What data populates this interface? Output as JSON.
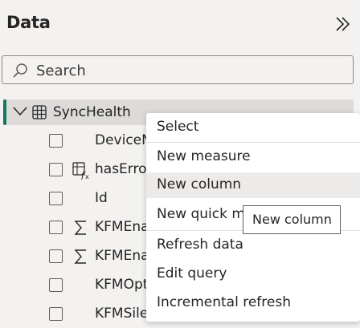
{
  "header": {
    "title": "Data"
  },
  "search": {
    "placeholder": "Search"
  },
  "table": {
    "name": "SyncHealth"
  },
  "fields": [
    {
      "name": "DeviceN",
      "icon": "none"
    },
    {
      "name": "hasError",
      "icon": "calculated-column-icon"
    },
    {
      "name": "Id",
      "icon": "none"
    },
    {
      "name": "KFMEna",
      "icon": "sigma-icon"
    },
    {
      "name": "KFMEna",
      "icon": "sigma-icon"
    },
    {
      "name": "KFMOpt",
      "icon": "none"
    },
    {
      "name": "KFMSile",
      "icon": "none"
    }
  ],
  "context_menu": {
    "items": [
      "Select",
      "New measure",
      "New column",
      "New quick measure",
      "Refresh data",
      "Edit query",
      "Incremental refresh"
    ],
    "hovered": "New column"
  },
  "tooltip": {
    "text": "New column"
  }
}
